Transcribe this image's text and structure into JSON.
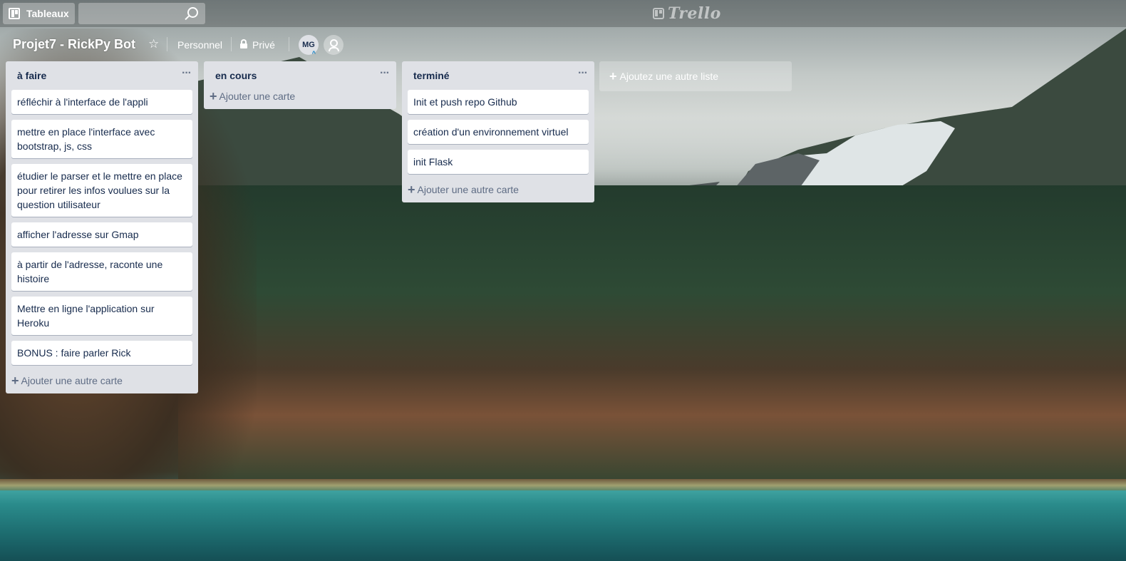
{
  "topbar": {
    "boards_label": "Tableaux",
    "search_value": "",
    "logo_text": "Trello"
  },
  "board": {
    "title": "Projet7 - RickPy Bot",
    "team": "Personnel",
    "visibility": "Privé",
    "member_initials": "MG"
  },
  "lists": [
    {
      "name": "à faire",
      "menu": "···",
      "cards": [
        "réfléchir à l'interface de l'appli",
        "mettre en place l'interface avec bootstrap, js, css",
        "étudier le parser et le mettre en place pour retirer les infos voulues sur la question utilisateur",
        "afficher l'adresse sur Gmap",
        "à partir de l'adresse, raconte une histoire",
        "Mettre en ligne l'application sur Heroku",
        "BONUS : faire parler Rick"
      ],
      "add_label": "Ajouter une autre carte"
    },
    {
      "name": "en cours",
      "menu": "···",
      "cards": [],
      "add_label": "Ajouter une carte"
    },
    {
      "name": "terminé",
      "menu": "···",
      "cards": [
        "Init et push repo Github",
        "création d'un environnement virtuel",
        "init Flask"
      ],
      "add_label": "Ajouter une autre carte"
    }
  ],
  "add_list_label": "Ajoutez une autre liste",
  "icons": {
    "boards": "boards-icon",
    "search": "search-icon",
    "star": "star-icon",
    "lock": "lock-icon",
    "invite": "add-member-icon",
    "plus": "plus-icon"
  }
}
